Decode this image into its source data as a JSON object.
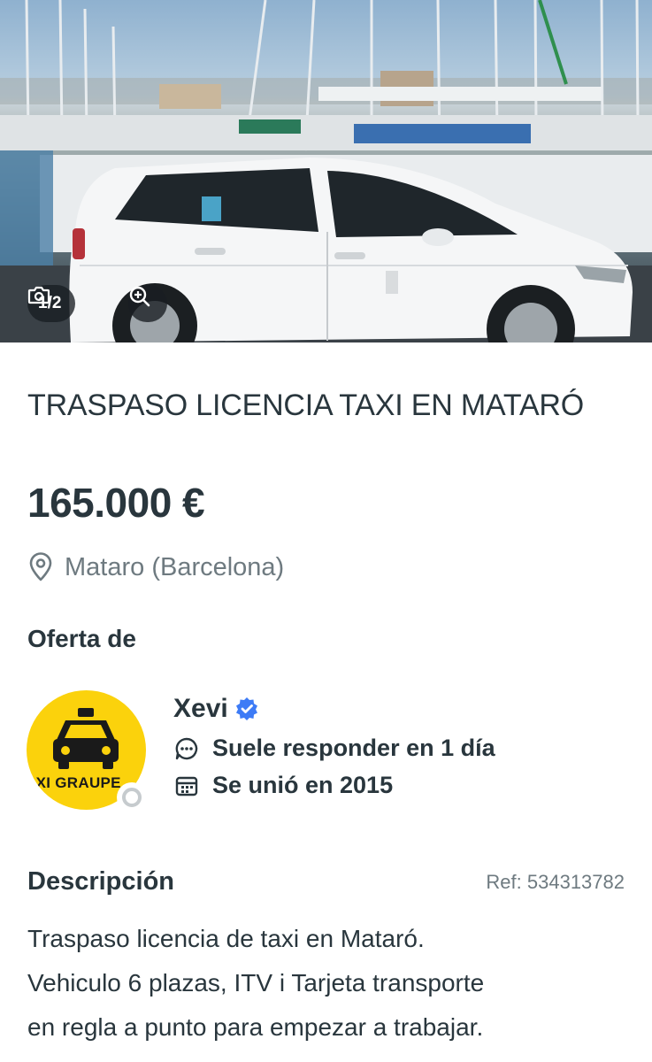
{
  "gallery": {
    "counter": "1/2",
    "camera_icon": "camera-icon",
    "zoom_icon": "zoom-in-icon"
  },
  "listing": {
    "title": "TRASPASO LICENCIA TAXI EN MATARÓ",
    "price": "165.000 €",
    "location": "Mataro (Barcelona)",
    "location_icon": "location-pin-icon"
  },
  "offer": {
    "heading": "Oferta de",
    "seller_name": "Xevi",
    "verified_icon": "verified-badge-icon",
    "avatar_text": "AXI GRAUPE",
    "reply_text": "Suele responder en 1 día",
    "reply_icon": "chat-bubble-icon",
    "joined_text": "Se unió en 2015",
    "joined_icon": "calendar-icon"
  },
  "description": {
    "heading": "Descripción",
    "ref": "Ref: 534313782",
    "body": "Traspaso licencia de taxi en Mataró.\nVehiculo 6 plazas,  ITV i Tarjeta transporte\nen regla a punto para empezar a trabajar."
  },
  "colors": {
    "text": "#29363d",
    "muted": "#6e7a80",
    "avatar_bg": "#fbd20c",
    "verified": "#3d7bf6"
  }
}
